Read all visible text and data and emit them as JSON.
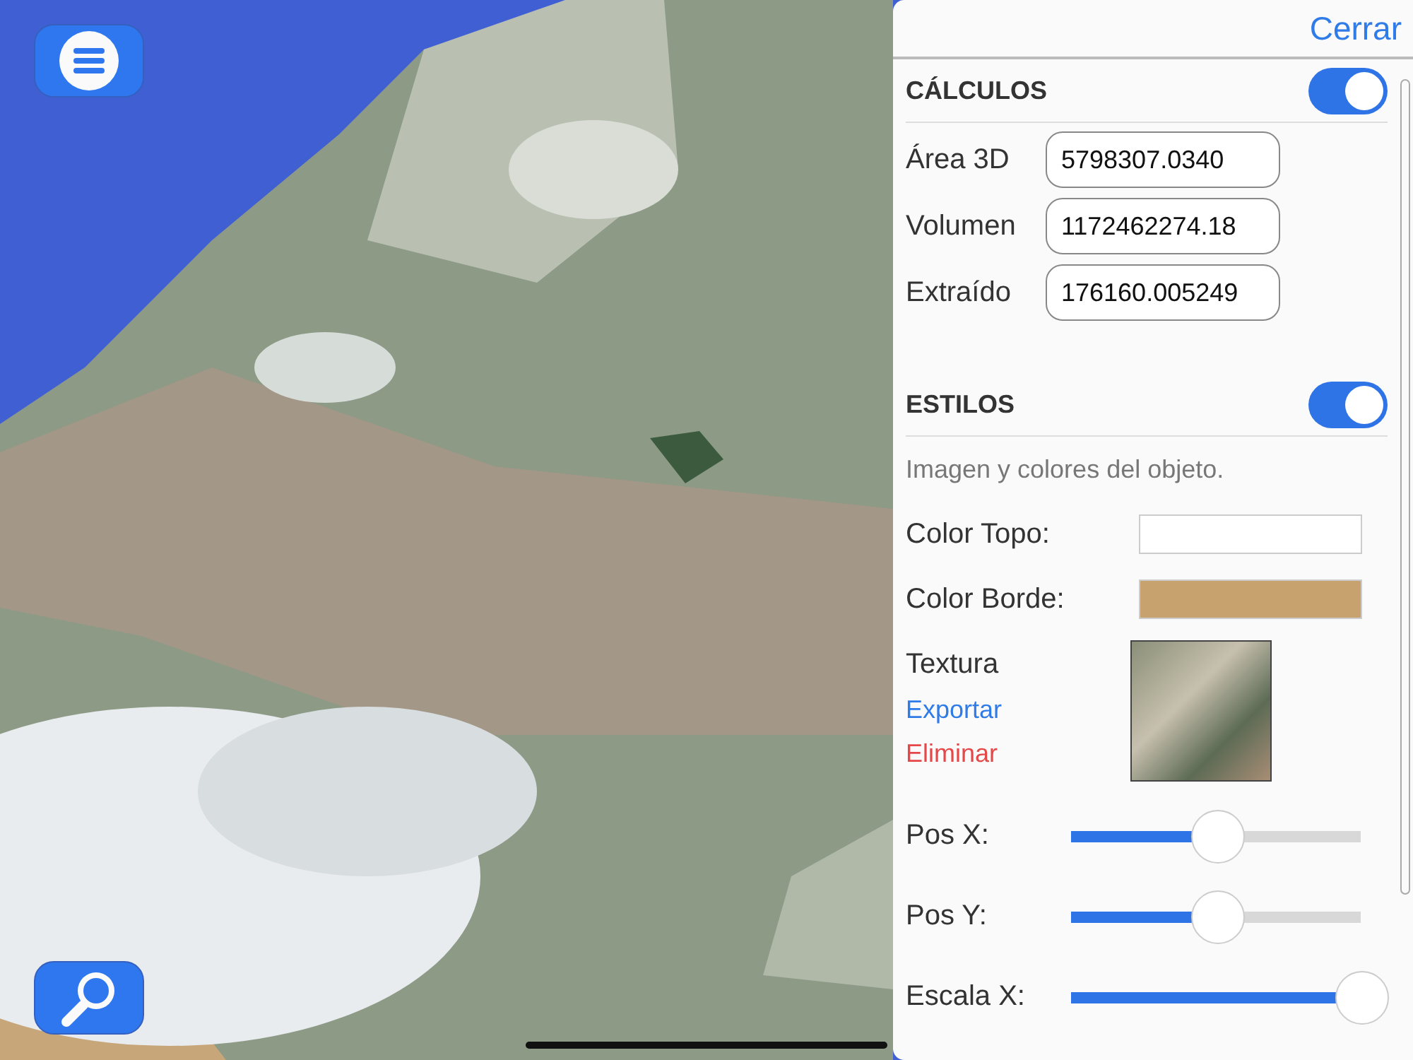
{
  "panel": {
    "close_label": "Cerrar",
    "sections": [
      {
        "kind": "fields",
        "title": "CÁLCULOS",
        "on": true,
        "fields": [
          {
            "label": "Área 3D",
            "value": "5798307.0340"
          },
          {
            "label": "Volumen",
            "value": "1172462274.18"
          },
          {
            "label": "Extraído",
            "value": "176160.005249"
          }
        ]
      },
      {
        "kind": "styles",
        "title": "ESTILOS",
        "on": true,
        "description": "Imagen y colores del objeto.",
        "colors": [
          {
            "label": "Color Topo:",
            "color": "#ffffff"
          },
          {
            "label": "Color Borde:",
            "color": "#c8a26e"
          }
        ],
        "texture": {
          "label": "Textura",
          "actions": [
            {
              "label": "Exportar",
              "kind": "link"
            },
            {
              "label": "Eliminar",
              "kind": "danger"
            }
          ]
        },
        "sliders": [
          {
            "label": "Pos X:",
            "level": 0.5
          },
          {
            "label": "Pos Y:",
            "level": 0.5
          },
          {
            "label": "Escala X:",
            "level": 1
          }
        ]
      }
    ]
  }
}
